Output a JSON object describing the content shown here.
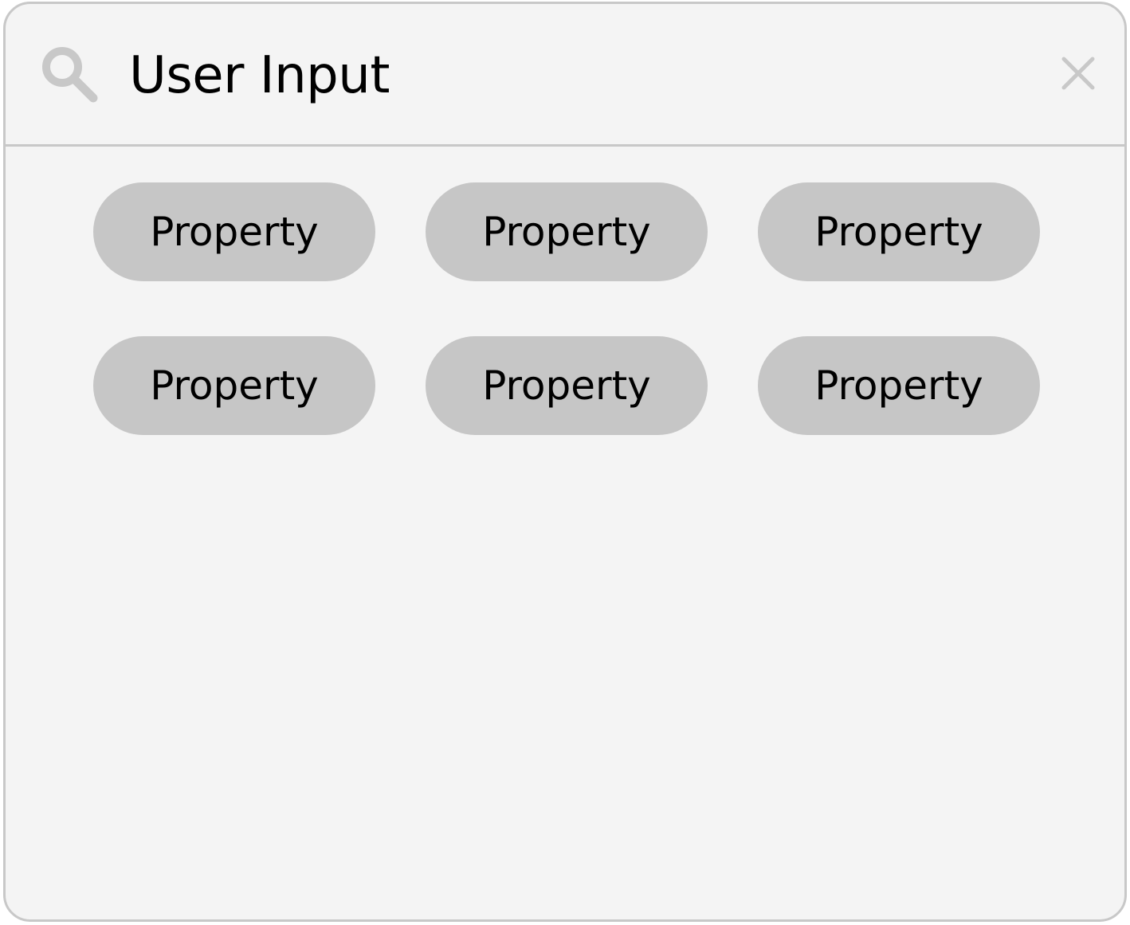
{
  "search": {
    "value": "User Input",
    "icon": "search-icon",
    "close_icon": "close-icon"
  },
  "chips": [
    {
      "label": "Property"
    },
    {
      "label": "Property"
    },
    {
      "label": "Property"
    },
    {
      "label": "Property"
    },
    {
      "label": "Property"
    },
    {
      "label": "Property"
    }
  ],
  "colors": {
    "panel_background": "#f4f4f4",
    "border": "#c8c8c8",
    "chip_background": "#c6c6c6",
    "icon": "#c8c8c8",
    "text": "#000000"
  }
}
